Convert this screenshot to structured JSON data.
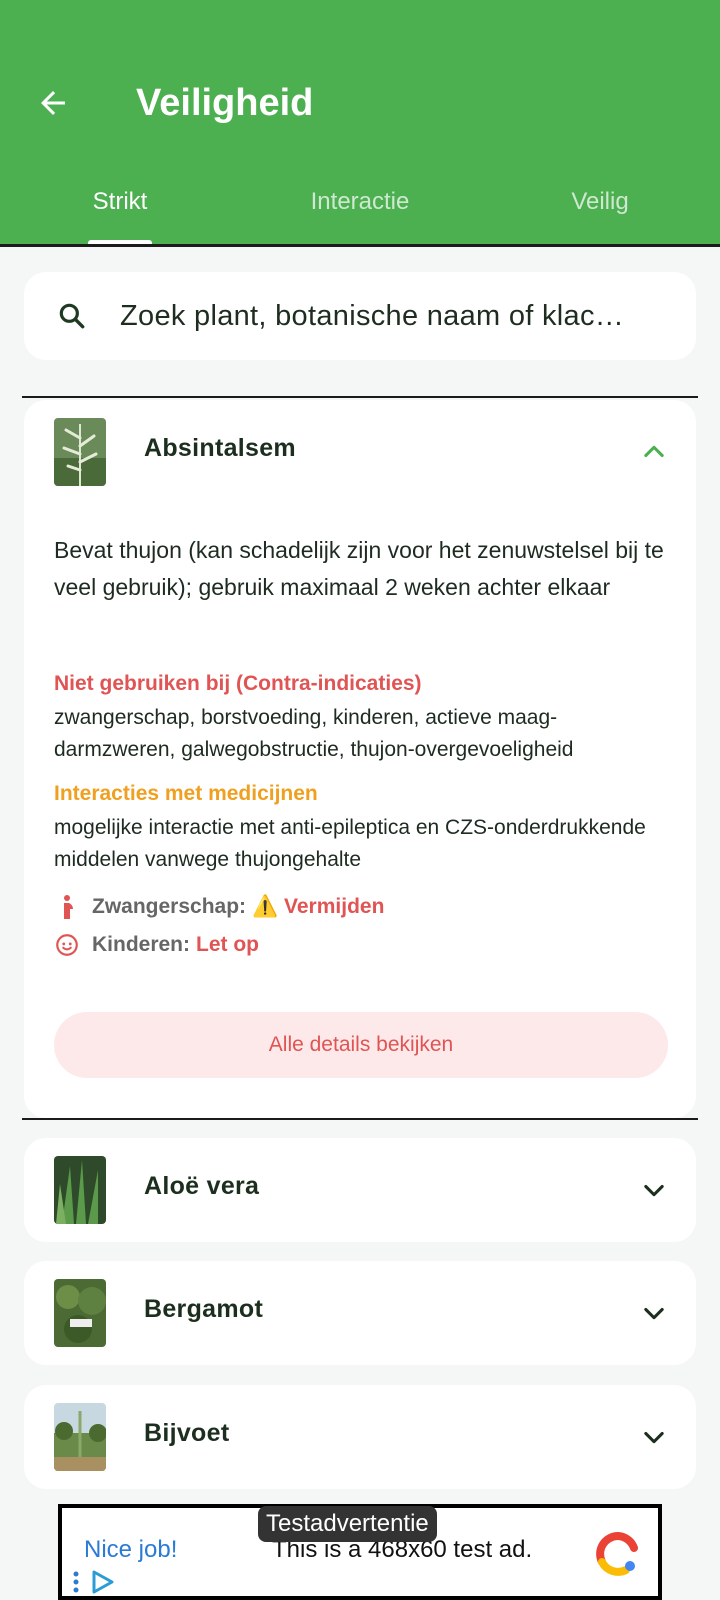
{
  "appbar": {
    "title": "Veiligheid",
    "tabs": [
      "Strikt",
      "Interactie",
      "Veilig"
    ]
  },
  "search": {
    "placeholder": "Zoek plant, botanische naam of klac…"
  },
  "plants": [
    {
      "name": "Absintalsem",
      "expanded": true,
      "description": "Bevat thujon (kan schadelijk zijn voor het zenuwstelsel bij te veel gebruik); gebruik maximaal 2 weken achter elkaar",
      "contra_title": "Niet gebruiken bij (Contra-indicaties)",
      "contra_text": "zwangerschap, borstvoeding, kinderen, actieve maag-darmzweren, galwegobstructie, thujon-overgevoeligheid",
      "interactions_title": "Interacties met medicijnen",
      "interactions_text": "mogelijke interactie met anti-epileptica en CZS-onderdrukkende middelen vanwege thujongehalte",
      "pregnancy_label": "Zwangerschap:",
      "pregnancy_value": "⚠️ Vermijden",
      "children_label": "Kinderen:",
      "children_value": "Let op",
      "details_button": "Alle details bekijken"
    },
    {
      "name": "Aloë vera",
      "expanded": false
    },
    {
      "name": "Bergamot",
      "expanded": false
    },
    {
      "name": "Bijvoet",
      "expanded": false
    }
  ],
  "ad": {
    "label": "Testadvertentie",
    "headline": "Nice job!",
    "text": "This is a 468x60 test ad."
  },
  "colors": {
    "primary": "#4caf50",
    "danger": "#e05454",
    "warning": "#f0a020",
    "background": "#f5f7f6"
  },
  "icons": [
    "back-arrow-icon",
    "search-icon",
    "chevron-up-icon",
    "chevron-down-icon",
    "pregnant-woman-icon",
    "child-face-icon"
  ]
}
